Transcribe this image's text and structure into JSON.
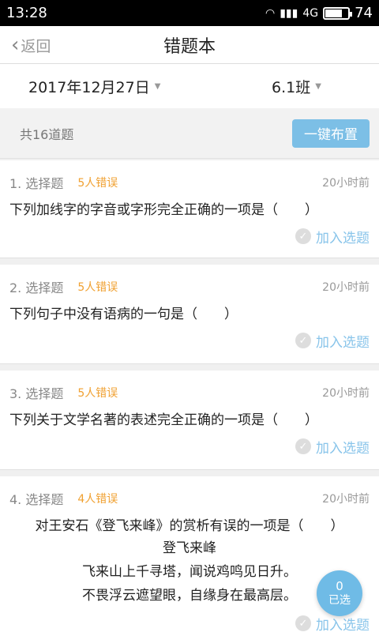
{
  "status": {
    "time": "13:28",
    "network": "4G",
    "battery": "74",
    "battery_level": 0.74
  },
  "nav": {
    "back_label": "返回",
    "title": "错题本"
  },
  "filter": {
    "date": "2017年12月27日",
    "class_name": "6.1班"
  },
  "summary": {
    "count_text": "共16道题",
    "assign_label": "一键布置"
  },
  "questions": [
    {
      "type": "1. 选择题",
      "errors": "5人错误",
      "time": "20小时前",
      "text": "下列加线字的字音或字形完全正确的一项是（　　）",
      "add_label": "加入选题"
    },
    {
      "type": "2. 选择题",
      "errors": "5人错误",
      "time": "20小时前",
      "text": "下列句子中没有语病的一句是（　　）",
      "add_label": "加入选题"
    },
    {
      "type": "3. 选择题",
      "errors": "5人错误",
      "time": "20小时前",
      "text": "下列关于文学名著的表述完全正确的一项是（　　）",
      "add_label": "加入选题"
    },
    {
      "type": "4. 选择题",
      "errors": "4人错误",
      "time": "20小时前",
      "text": "对王安石《登飞来峰》的赏析有误的一项是（　　）",
      "poem": [
        "登飞来峰",
        "飞来山上千寻塔，闻说鸡鸣见日升。",
        "不畏浮云遮望眼，自缘身在最高层。"
      ],
      "add_label": "加入选题"
    }
  ],
  "fab": {
    "count": "0",
    "label": "已选"
  },
  "colors": {
    "accent": "#7cbfe6",
    "error": "#f0a030",
    "link": "#88c4ea"
  }
}
